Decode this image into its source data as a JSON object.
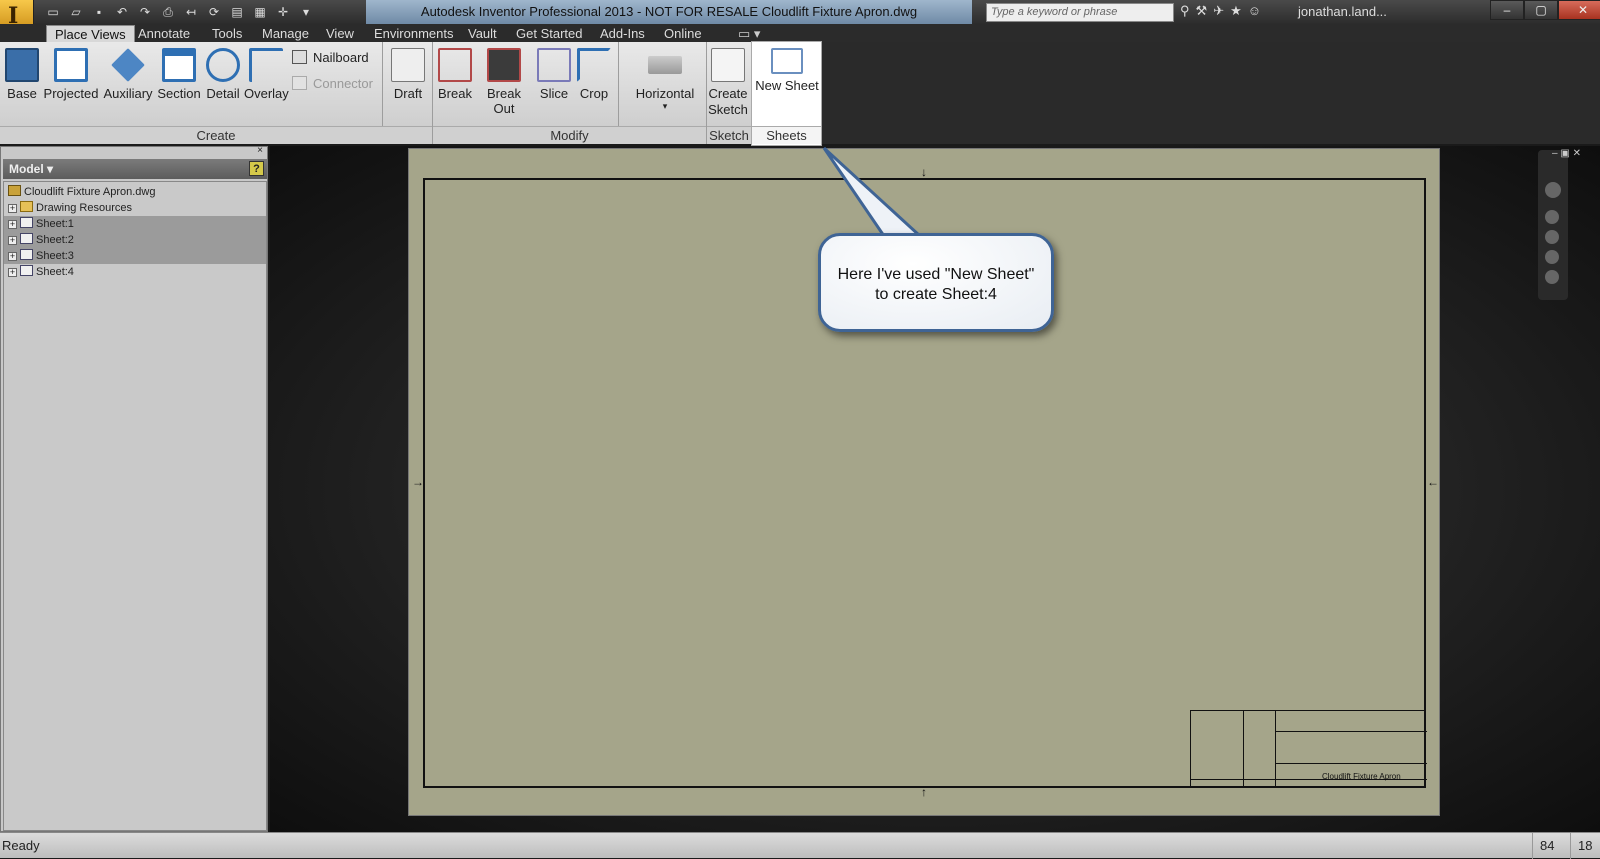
{
  "window": {
    "title": "Autodesk Inventor Professional 2013 - NOT FOR RESALE   Cloudlift Fixture Apron.dwg",
    "search_placeholder": "Type a keyword or phrase",
    "username": "jonathan.land...",
    "app_button_label": "I"
  },
  "tabs": [
    "Place Views",
    "Annotate",
    "Tools",
    "Manage",
    "View",
    "Environments",
    "Vault",
    "Get Started",
    "Add-Ins",
    "Online"
  ],
  "ribbon": {
    "create": [
      "Base",
      "Projected",
      "Auxiliary",
      "Section",
      "Detail",
      "Overlay"
    ],
    "nailboard": "Nailboard",
    "connector": "Connector",
    "draft": "Draft",
    "modify": [
      "Break",
      "Break Out",
      "Slice",
      "Crop"
    ],
    "horizontal": "Horizontal",
    "create_sketch": "Create Sketch",
    "new_sheet": "New Sheet",
    "panels": {
      "create": "Create",
      "modify": "Modify",
      "sketch": "Sketch",
      "sheets": "Sheets"
    }
  },
  "browser": {
    "title": "Model",
    "help": "?",
    "root": "Cloudlift Fixture Apron.dwg",
    "items": [
      "Drawing Resources",
      "Sheet:1",
      "Sheet:2",
      "Sheet:3",
      "Sheet:4"
    ]
  },
  "sheet": {
    "title_block_name": "Cloudlift Fixture Apron"
  },
  "callout": {
    "text": "Here I've used \"New Sheet\" to create Sheet:4"
  },
  "status": {
    "text": "Ready",
    "n1": "84",
    "n2": "18"
  },
  "colors": {
    "sheet": "#a5a58a",
    "callout_border": "#3f6495",
    "title_bar": "#6f8aa6"
  }
}
